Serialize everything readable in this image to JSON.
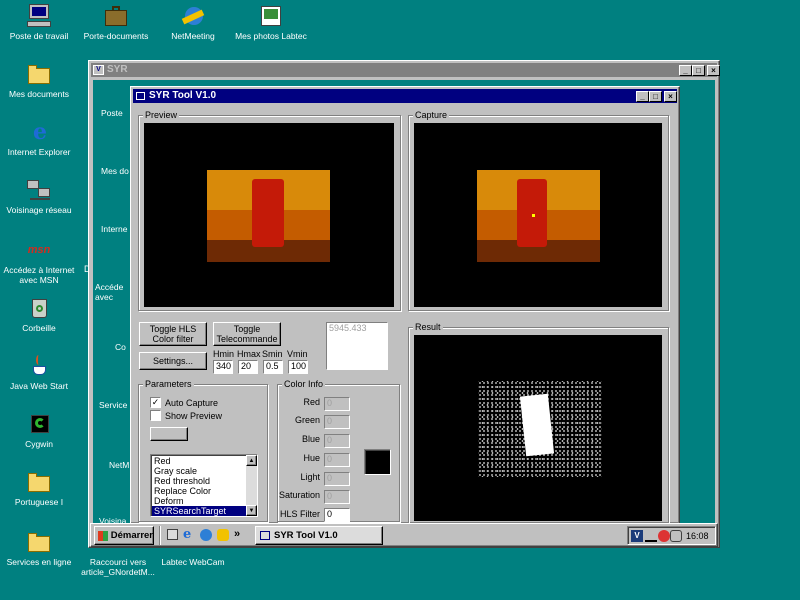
{
  "desktop": {
    "icons": [
      {
        "label": "Poste de travail"
      },
      {
        "label": "Porte-documents"
      },
      {
        "label": "NetMeeting"
      },
      {
        "label": "Mes photos Labtec"
      },
      {
        "label": "Mes documents"
      },
      {
        "label": "Internet Explorer"
      },
      {
        "label": "Voisinage réseau"
      },
      {
        "label": "Accédez à Internet avec MSN"
      },
      {
        "label": "Corbeille"
      },
      {
        "label": "Java Web Start"
      },
      {
        "label": "Cygwin"
      },
      {
        "label": "Portuguese I"
      },
      {
        "label": "Services en ligne"
      },
      {
        "label": "Raccourci vers article_GNordetM..."
      },
      {
        "label": "Labtec WebCam"
      }
    ],
    "partial_labels": {
      "d": "D",
      "labtec": "abtec"
    }
  },
  "explorer_window": {
    "title": "SYR",
    "partial_icons": [
      "Poste",
      "Mes do",
      "Interne",
      "Accéde avec",
      "Co",
      "Service",
      "NetM",
      "Voisina"
    ]
  },
  "tool_window": {
    "title": "SYR Tool V1.0",
    "preview_label": "Preview",
    "capture_label": "Capture",
    "result_label": "Result",
    "toggle_hls_label": "Toggle HLS Color filter",
    "toggle_telecommande_label": "Toggle Telecommande",
    "settings_label": "Settings...",
    "status_value": "5945.433",
    "hls_headers": [
      "Hmin",
      "Hmax",
      "Smin",
      "Vmin"
    ],
    "hls_values": [
      "340",
      "20",
      "0.5",
      "100"
    ],
    "parameters": {
      "label": "Parameters",
      "auto_capture_label": "Auto Capture",
      "auto_capture_checked": true,
      "show_preview_label": "Show Preview",
      "show_preview_checked": false,
      "filter_options": [
        "Red",
        "Gray scale",
        "Red threshold",
        "Replace Color",
        "Deform",
        "SYRSearchTarget"
      ],
      "selected_filter": "SYRSearchTarget"
    },
    "color_info": {
      "label": "Color Info",
      "red_label": "Red",
      "red_value": "0",
      "green_label": "Green",
      "green_value": "0",
      "blue_label": "Blue",
      "blue_value": "0",
      "hue_label": "Hue",
      "hue_value": "0",
      "light_label": "Light",
      "light_value": "0",
      "saturation_label": "Saturation",
      "saturation_value": "0",
      "hls_filter_label": "HLS Filter",
      "hls_filter_value": "0",
      "swatch_color": "#000000"
    }
  },
  "taskbar": {
    "start_label": "Démarrer",
    "quicklaunch_more": "»",
    "task_label": "SYR Tool V1.0",
    "clock": "16:08"
  },
  "colors": {
    "desktop": "#008080",
    "titlebar": "#000080",
    "face": "#c0c0c0",
    "video_bg": "#000000",
    "tracked_object": "#c41a08"
  }
}
